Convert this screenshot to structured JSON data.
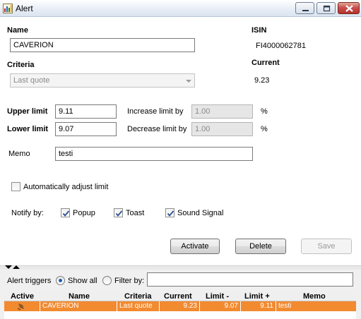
{
  "window": {
    "title": "Alert",
    "icon": "chart-app-icon"
  },
  "form": {
    "name_label": "Name",
    "name_value": "CAVERION",
    "isin_label": "ISIN",
    "isin_value": "FI4000062781",
    "criteria_label": "Criteria",
    "criteria_value": "Last quote",
    "current_label": "Current",
    "current_value": "9.23",
    "upper_limit_label": "Upper limit",
    "upper_limit_value": "9.11",
    "increase_limit_label": "Increase limit by",
    "increase_limit_value": "1.00",
    "lower_limit_label": "Lower limit",
    "lower_limit_value": "9.07",
    "decrease_limit_label": "Decrease limit by",
    "decrease_limit_value": "1.00",
    "percent": "%",
    "memo_label": "Memo",
    "memo_value": "testi",
    "auto_adjust_label": "Automatically adjust limit",
    "auto_adjust_checked": false,
    "notify_label": "Notify by:",
    "notify": [
      {
        "label": "Popup",
        "checked": true
      },
      {
        "label": "Toast",
        "checked": true
      },
      {
        "label": "Sound Signal",
        "checked": true
      }
    ]
  },
  "buttons": {
    "activate": "Activate",
    "delete": "Delete",
    "save": "Save"
  },
  "triggers": {
    "label": "Alert triggers",
    "show_all": "Show all",
    "filter_by": "Filter by:",
    "filter_value": "",
    "selected": "show_all"
  },
  "table": {
    "columns": [
      "Active",
      "Name",
      "Criteria",
      "Current",
      "Limit -",
      "Limit +",
      "Memo"
    ],
    "rows": [
      {
        "active_icon": "bell-icon",
        "name": "CAVERION",
        "criteria": "Last quote",
        "current": "9.23",
        "limit_minus": "9.07",
        "limit_plus": "9.11",
        "memo": "testi"
      }
    ],
    "selected_row_color": "#f28a30"
  },
  "colors": {
    "close_button": "#c75050",
    "radio_dot": "#1c5fb0",
    "check": "#2a4f8f"
  }
}
